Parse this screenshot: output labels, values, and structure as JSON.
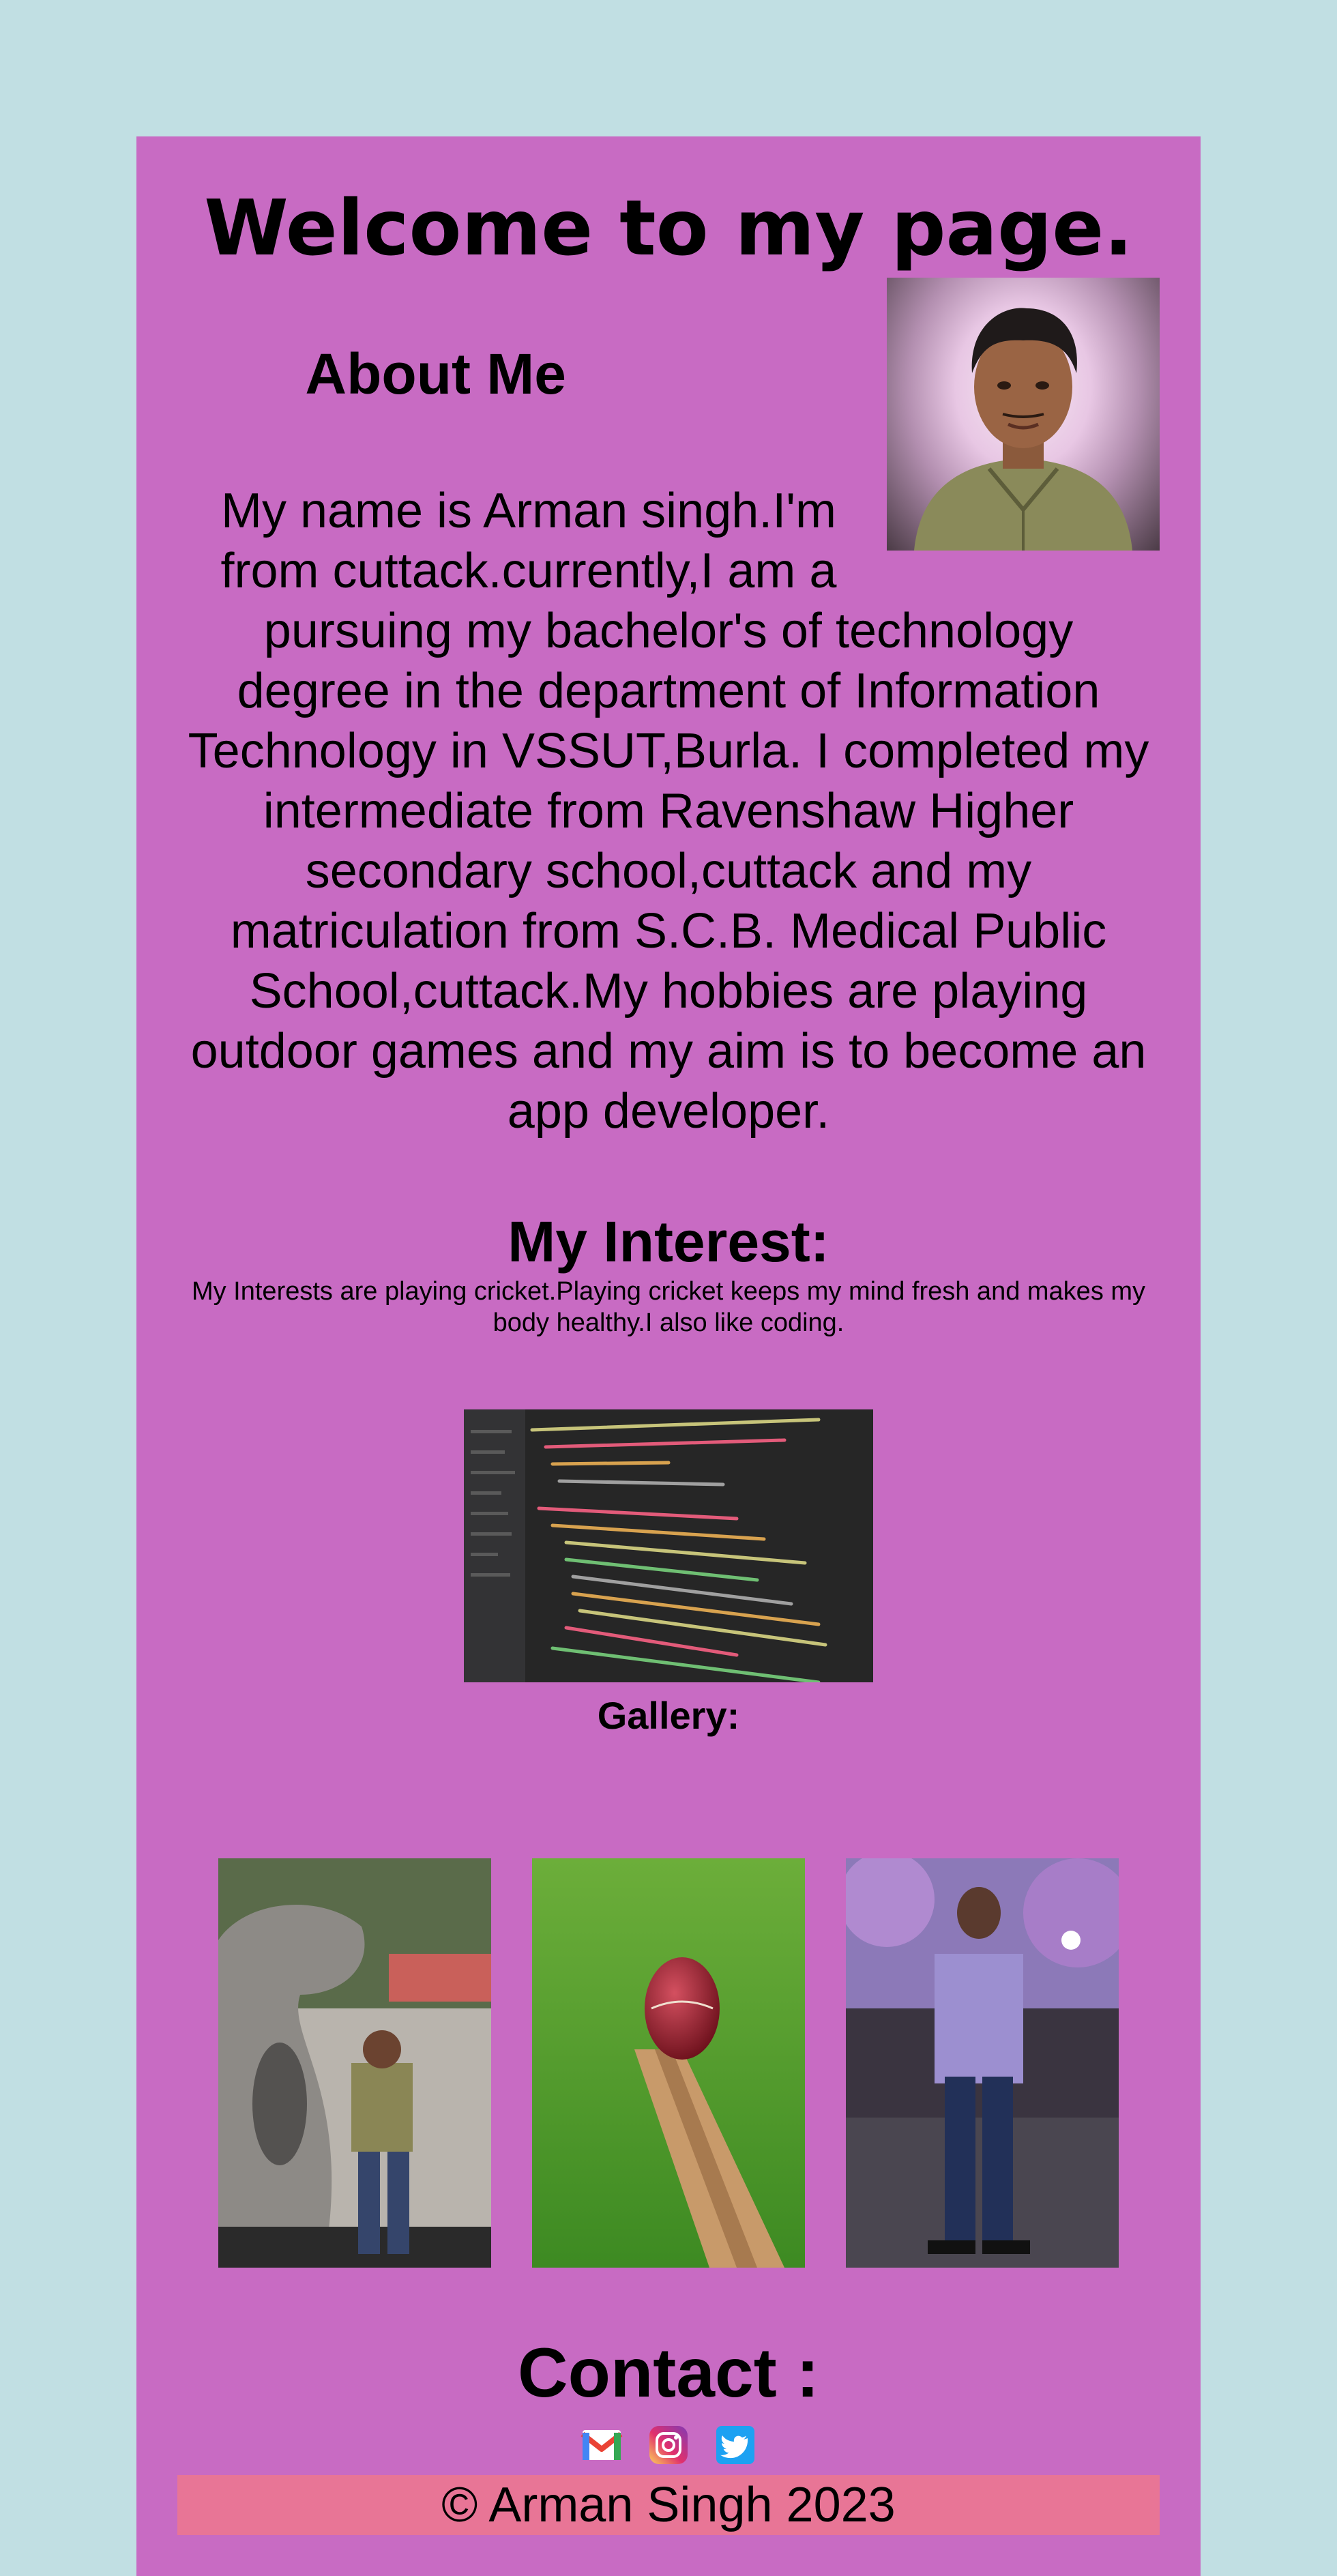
{
  "header": {
    "title": "Welcome to my page."
  },
  "about": {
    "heading": "About Me",
    "text": "My name is Arman singh.I'm from cuttack.currently,I am a pursuing my bachelor's of technology degree in the department of Information Technology in VSSUT,Burla. I completed my intermediate from Ravenshaw Higher secondary school,cuttack and my matriculation from S.C.B. Medical Public School,cuttack.My hobbies are playing outdoor games and my aim is to become an app developer."
  },
  "interest": {
    "heading": "My Interest:",
    "text": "My Interests are playing cricket.Playing cricket keeps my mind fresh and makes my body healthy.I also like coding."
  },
  "gallery": {
    "heading": "Gallery:"
  },
  "contact": {
    "heading": "Contact :",
    "icons": [
      "gmail-icon",
      "instagram-icon",
      "twitter-icon"
    ]
  },
  "footer": {
    "text": "© Arman Singh 2023"
  },
  "colors": {
    "page_background": "#c1dfe3",
    "card_background": "#c86bc3",
    "footer_background": "#e87596"
  }
}
